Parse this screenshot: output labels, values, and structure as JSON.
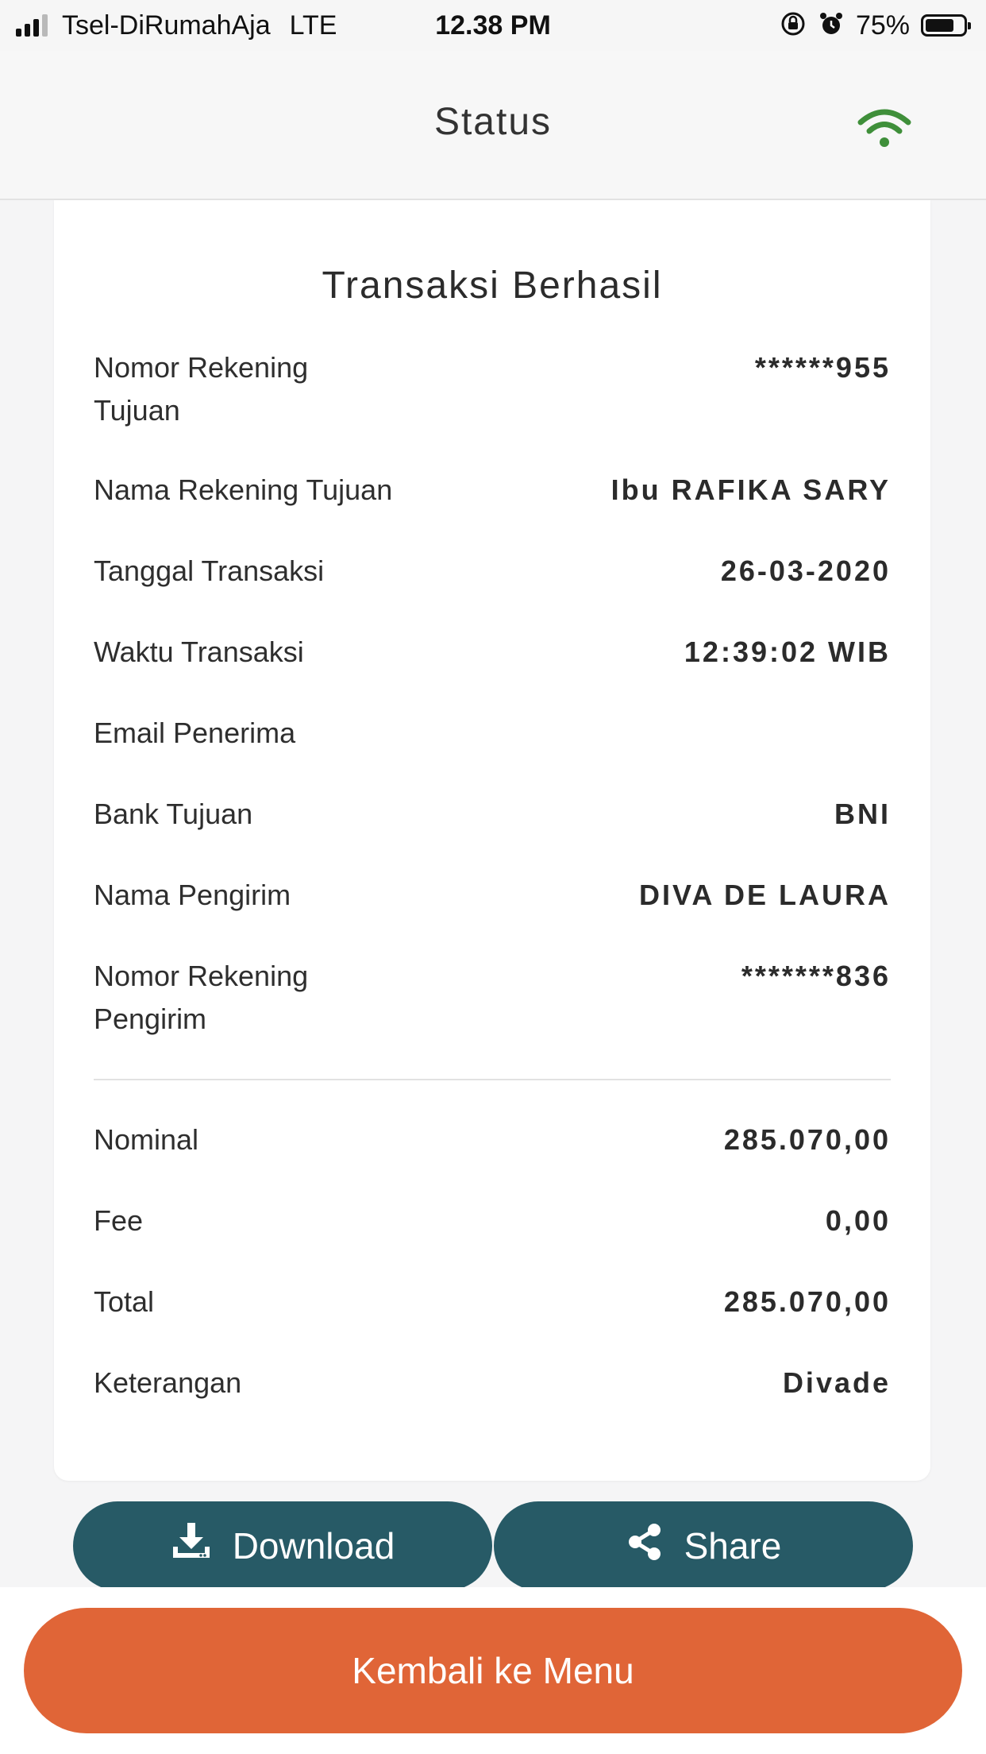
{
  "status_bar": {
    "carrier": "Tsel-DiRumahAja",
    "network": "LTE",
    "time": "12.38 PM",
    "battery": "75%",
    "battery_level": 0.75
  },
  "header": {
    "title": "Status",
    "connection_icon": "wifi-icon",
    "connection_color": "#3f8f3a"
  },
  "receipt": {
    "title": "Transaksi Berhasil",
    "rows": [
      {
        "label": "Nomor Rekening Tujuan",
        "value": "******955"
      },
      {
        "label": "Nama Rekening Tujuan",
        "value": "Ibu RAFIKA SARY"
      },
      {
        "label": "Tanggal Transaksi",
        "value": "26-03-2020"
      },
      {
        "label": "Waktu Transaksi",
        "value": "12:39:02 WIB"
      },
      {
        "label": "Email Penerima",
        "value": ""
      },
      {
        "label": "Bank Tujuan",
        "value": "BNI"
      },
      {
        "label": "Nama Pengirim",
        "value": "DIVA DE LAURA"
      },
      {
        "label": "Nomor Rekening Pengirim",
        "value": "*******836"
      }
    ],
    "amount_rows": [
      {
        "label": "Nominal",
        "value": "285.070,00"
      },
      {
        "label": "Fee",
        "value": "0,00"
      },
      {
        "label": "Total",
        "value": "285.070,00"
      },
      {
        "label": "Keterangan",
        "value": "Divade"
      }
    ]
  },
  "actions": {
    "download_label": "Download",
    "share_label": "Share",
    "back_label": "Kembali ke Menu"
  },
  "colors": {
    "primary_button": "#275a66",
    "back_button": "#e06537"
  }
}
